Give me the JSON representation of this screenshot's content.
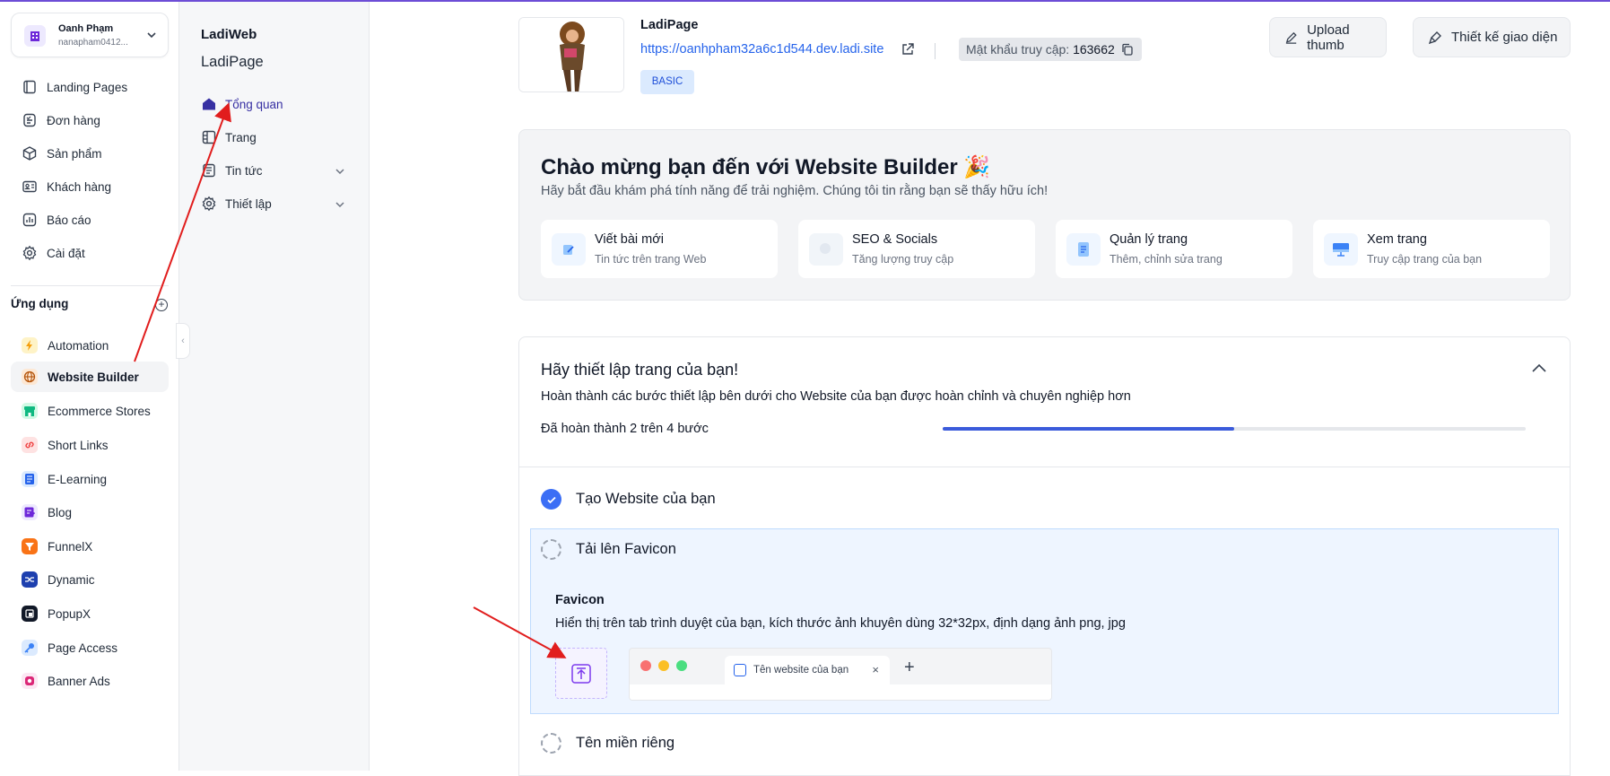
{
  "account": {
    "name": "Oanh Phạm",
    "email": "nanapham0412..."
  },
  "nav": {
    "items": [
      {
        "label": "Landing Pages",
        "icon": "book-icon"
      },
      {
        "label": "Đơn hàng",
        "icon": "order-icon"
      },
      {
        "label": "Sản phẩm",
        "icon": "box-icon"
      },
      {
        "label": "Khách hàng",
        "icon": "contact-card-icon"
      },
      {
        "label": "Báo cáo",
        "icon": "chart-icon"
      },
      {
        "label": "Cài đặt",
        "icon": "gear-icon"
      }
    ]
  },
  "apps": {
    "title": "Ứng dụng",
    "items": [
      {
        "label": "Automation",
        "color": "#f59e0b"
      },
      {
        "label": "Website Builder",
        "color": "#b45309"
      },
      {
        "label": "Ecommerce Stores",
        "color": "#10b981"
      },
      {
        "label": "Short Links",
        "color": "#ef4444"
      },
      {
        "label": "E-Learning",
        "color": "#2563eb"
      },
      {
        "label": "Blog",
        "color": "#6d28d9"
      },
      {
        "label": "FunnelX",
        "color": "#f97316"
      },
      {
        "label": "Dynamic",
        "color": "#1e40af"
      },
      {
        "label": "PopupX",
        "color": "#111827"
      },
      {
        "label": "Page Access",
        "color": "#3b82f6"
      },
      {
        "label": "Banner Ads",
        "color": "#db2777"
      }
    ]
  },
  "sub": {
    "title1": "LadiWeb",
    "title2": "LadiPage",
    "items": [
      {
        "label": "Tổng quan",
        "icon": "home-icon"
      },
      {
        "label": "Trang",
        "icon": "page-icon"
      },
      {
        "label": "Tin tức",
        "icon": "news-icon"
      },
      {
        "label": "Thiết lập",
        "icon": "gear-icon"
      }
    ]
  },
  "site": {
    "name": "LadiPage",
    "url": "https://oanhpham32a6c1d544.dev.ladi.site",
    "password_label": "Mật khẩu truy cập:",
    "password": "163662",
    "plan": "BASIC"
  },
  "actions": {
    "upload_thumb": "Upload thumb",
    "design": "Thiết kế giao diện"
  },
  "welcome": {
    "title": "Chào mừng bạn đến với Website Builder 🎉",
    "subtitle": "Hãy bắt đầu khám phá tính năng để trải nghiệm. Chúng tôi tin rằng bạn sẽ thấy hữu ích!",
    "cards": [
      {
        "title": "Viết bài mới",
        "sub": "Tin tức trên trang Web"
      },
      {
        "title": "SEO & Socials",
        "sub": "Tăng lượng truy cập"
      },
      {
        "title": "Quản lý trang",
        "sub": "Thêm, chỉnh sửa trang"
      },
      {
        "title": "Xem trang",
        "sub": "Truy cập trang của bạn"
      }
    ]
  },
  "setup": {
    "title": "Hãy thiết lập trang của bạn!",
    "desc": "Hoàn thành các bước thiết lập bên dưới cho Website của bạn được hoàn chỉnh và chuyên nghiệp hơn",
    "progress_label": "Đã hoàn thành 2 trên 4 bước",
    "progress": 0.5,
    "steps": [
      {
        "label": "Tạo Website của bạn",
        "done": true
      },
      {
        "label": "Tải lên Favicon",
        "done": false
      },
      {
        "label": "Tên miền riêng",
        "done": false
      }
    ],
    "favicon": {
      "title": "Favicon",
      "desc": "Hiển thị trên tab trình duyệt của bạn, kích thước ảnh khuyên dùng 32*32px, định dạng ảnh png, jpg",
      "tab_label": "Tên website của bạn",
      "tab_close": "×",
      "new_tab": "+"
    }
  }
}
